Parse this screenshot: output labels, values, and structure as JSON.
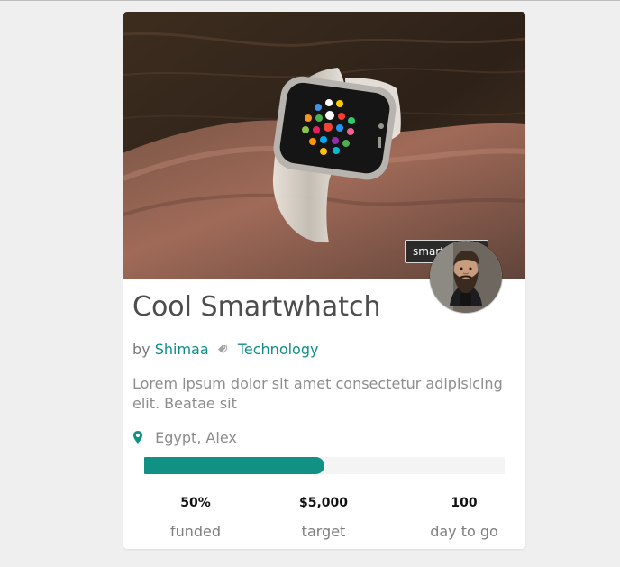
{
  "image_tooltip": "smart watch",
  "card": {
    "title": "Cool Smartwhatch",
    "meta": {
      "by_label": "by",
      "author": "Shimaa",
      "category": "Technology"
    },
    "description": "Lorem ipsum dolor sit amet consectetur adipisicing elit. Beatae sit",
    "location": "Egypt, Alex",
    "progress_fraction": 0.5,
    "stats": [
      {
        "value": "50%",
        "label": "funded"
      },
      {
        "value": "$5,000",
        "label": "target"
      },
      {
        "value": "100",
        "label": "day to go"
      }
    ]
  },
  "colors": {
    "accent": "#119183",
    "link": "#0f8d88"
  },
  "icons": {
    "tag": "tag-icon",
    "location": "location-pin-icon"
  }
}
